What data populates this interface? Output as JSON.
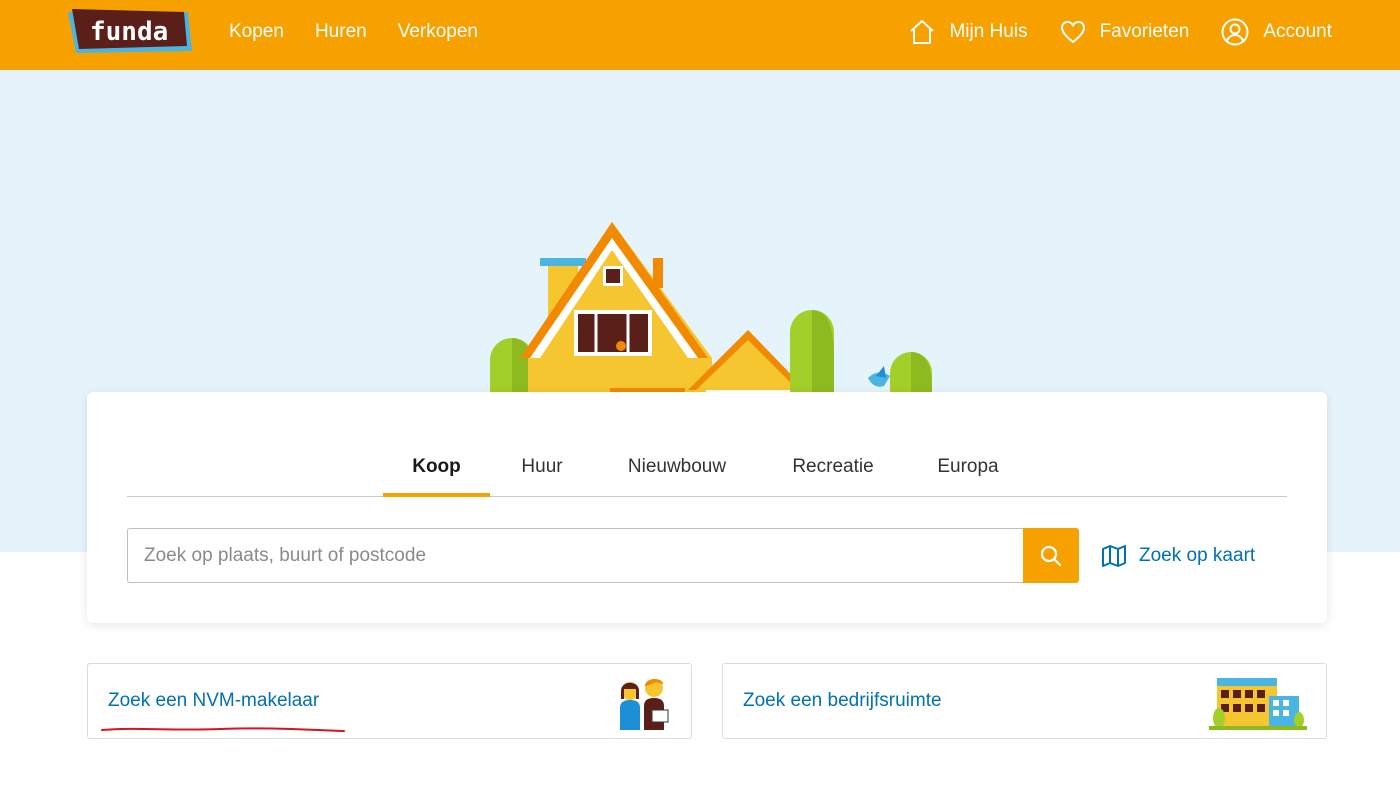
{
  "brand": {
    "logo_text": "funda",
    "primary_color": "#f7a100",
    "link_color": "#0071b3",
    "hero_bg": "#e5f4fb"
  },
  "header": {
    "nav_left": [
      "Kopen",
      "Huren",
      "Verkopen"
    ],
    "my_house": {
      "label": "Mijn Huis",
      "icon": "house-icon"
    },
    "favorites": {
      "label": "Favorieten",
      "icon": "heart-icon"
    },
    "account": {
      "label": "Account",
      "icon": "user-icon"
    }
  },
  "search": {
    "tabs": [
      {
        "label": "Koop",
        "active": true
      },
      {
        "label": "Huur",
        "active": false
      },
      {
        "label": "Nieuwbouw",
        "active": false
      },
      {
        "label": "Recreatie",
        "active": false
      },
      {
        "label": "Europa",
        "active": false
      }
    ],
    "placeholder": "Zoek op plaats, buurt of postcode",
    "search_icon": "search-icon",
    "map_link": {
      "label": "Zoek op kaart",
      "icon": "map-icon"
    }
  },
  "links": {
    "broker": {
      "label": "Zoek een NVM-makelaar",
      "icon": "brokers-illustration"
    },
    "business": {
      "label": "Zoek een bedrijfsruimte",
      "icon": "office-building-illustration"
    }
  }
}
